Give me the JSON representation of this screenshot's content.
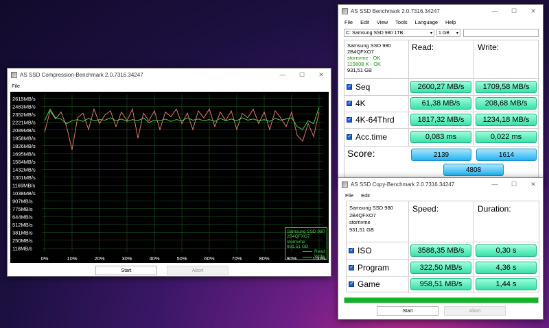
{
  "compression": {
    "title": "AS SSD Compression-Benchmark 2.0.7316.34247",
    "menu": [
      "File"
    ],
    "y_labels": [
      "2615MB/s",
      "2483MB/s",
      "2352MB/s",
      "2221MB/s",
      "2089MB/s",
      "1958MB/s",
      "1826MB/s",
      "1695MB/s",
      "1564MB/s",
      "1432MB/s",
      "1301MB/s",
      "1169MB/s",
      "1038MB/s",
      "907MB/s",
      "775MB/s",
      "644MB/s",
      "512MB/s",
      "381MB/s",
      "250MB/s",
      "118MB/s"
    ],
    "x_labels": [
      "0%",
      "10%",
      "20%",
      "30%",
      "40%",
      "50%",
      "60%",
      "70%",
      "80%",
      "90%",
      "100%"
    ],
    "legend": {
      "device": "Samsung SSD 980",
      "firmware": "2B4QFXO7",
      "driver": "stornvme",
      "size": "931,51 GB",
      "read": "Read",
      "write": "Write"
    },
    "start": "Start",
    "abort": "Abort",
    "colors": {
      "read": "#e07a6e",
      "write": "#4fd14f",
      "plot_bg": "#000000",
      "grid": "#1f5a1f"
    }
  },
  "chart_data": {
    "type": "line",
    "x": [
      0,
      2,
      4,
      6,
      8,
      10,
      12,
      14,
      16,
      18,
      20,
      22,
      24,
      26,
      28,
      30,
      32,
      34,
      36,
      38,
      40,
      42,
      44,
      46,
      48,
      50,
      52,
      54,
      56,
      58,
      60,
      62,
      64,
      66,
      68,
      70,
      72,
      74,
      76,
      78,
      80,
      82,
      84,
      86,
      88,
      90,
      92,
      94,
      96,
      98,
      100
    ],
    "series": [
      {
        "name": "Read",
        "values": [
          2050,
          2420,
          2280,
          2400,
          2150,
          1750,
          2300,
          2380,
          2100,
          2450,
          2200,
          2350,
          2420,
          2150,
          2400,
          2250,
          2450,
          1950,
          2380,
          2250,
          2420,
          2100,
          2400,
          2320,
          2450,
          2200,
          2380,
          2100,
          2420,
          2300,
          2450,
          2150,
          2400,
          2250,
          2420,
          2100,
          2380,
          2300,
          2450,
          2200,
          2400,
          2100,
          2420,
          2300,
          2150,
          2400,
          2000,
          1900,
          2200,
          1980,
          2400
        ]
      },
      {
        "name": "Write",
        "values": [
          2250,
          2450,
          2300,
          2280,
          2200,
          2250,
          2270,
          2240,
          2290,
          2250,
          2270,
          2260,
          2300,
          2250,
          2280,
          2240,
          2270,
          2250,
          2300,
          2220,
          2260,
          2250,
          2280,
          2240,
          2270,
          2250,
          2300,
          2260,
          2280,
          2250,
          2270,
          2240,
          2290,
          2250,
          2280,
          2250,
          2300,
          2260,
          2280,
          2250,
          2270,
          2240,
          2290,
          2260,
          2280,
          2300,
          2150,
          2100,
          2250,
          2200,
          2480
        ]
      }
    ],
    "ylim": [
      0,
      2700
    ],
    "xlim": [
      0,
      100
    ],
    "grid": true,
    "legend_position": "bottom-right"
  },
  "benchmark": {
    "title": "AS SSD Benchmark 2.0.7316.34247",
    "menu": [
      "File",
      "Edit",
      "View",
      "Tools",
      "Language",
      "Help"
    ],
    "drive_select": "C: Samsung SSD 980 1TB",
    "size_select": "1 GB",
    "info": {
      "model": "Samsung SSD 980",
      "firmware": "2B4QFXO7",
      "driver": "stornvme - OK",
      "align": "119808 K - OK",
      "size": "931,51 GB"
    },
    "read_header": "Read:",
    "write_header": "Write:",
    "rows": [
      {
        "label": "Seq",
        "read": "2600,27 MB/s",
        "write": "1709,58 MB/s"
      },
      {
        "label": "4K",
        "read": "61,38 MB/s",
        "write": "208,68 MB/s"
      },
      {
        "label": "4K-64Thrd",
        "read": "1817,32 MB/s",
        "write": "1234,18 MB/s"
      },
      {
        "label": "Acc.time",
        "read": "0,083 ms",
        "write": "0,022 ms"
      }
    ],
    "score_label": "Score:",
    "score_read": "2139",
    "score_write": "1614",
    "score_total": "4808"
  },
  "copy": {
    "title": "AS SSD Copy-Benchmark 2.0.7316.34247",
    "menu": [
      "File",
      "Edit"
    ],
    "info": {
      "model": "Samsung SSD 980",
      "firmware": "2B4QFXO7",
      "driver": "stornvme",
      "size": "931,51 GB"
    },
    "speed_header": "Speed:",
    "duration_header": "Duration:",
    "rows": [
      {
        "label": "ISO",
        "speed": "3588,35 MB/s",
        "duration": "0,30 s"
      },
      {
        "label": "Program",
        "speed": "322,50 MB/s",
        "duration": "4,36 s"
      },
      {
        "label": "Game",
        "speed": "958,51 MB/s",
        "duration": "1,44 s"
      }
    ],
    "progress": 1.0,
    "start": "Start",
    "abort": "Abort"
  }
}
